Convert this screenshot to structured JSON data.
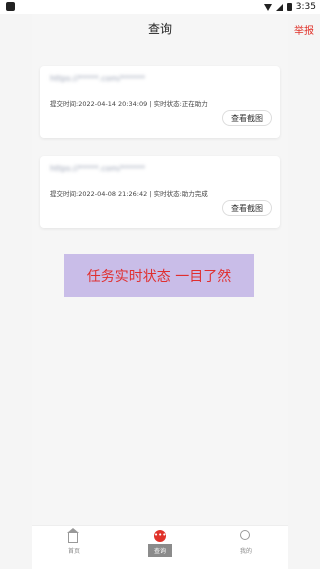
{
  "status_bar": {
    "time": "3:35",
    "icons": [
      "wifi-icon",
      "signal-icon",
      "battery-icon"
    ]
  },
  "header": {
    "title": "查询",
    "report_label": "举报"
  },
  "records": [
    {
      "url_masked": "https://*****.com/******",
      "submit_time_label": "提交时间:",
      "submit_time": "2022-04-14 20:34:09",
      "status_label": "实时状态:",
      "status": "正在助力",
      "view_button": "查看截图"
    },
    {
      "url_masked": "https://*****.com/******",
      "submit_time_label": "提交时间:",
      "submit_time": "2022-04-08 21:26:42",
      "status_label": "实时状态:",
      "status": "助力完成",
      "view_button": "查看截图"
    }
  ],
  "banner": {
    "text": "任务实时状态 一目了然",
    "background_color": "#c9bde8",
    "text_color": "#e02f2f"
  },
  "tabbar": {
    "items": [
      {
        "label": "首页",
        "icon": "home-icon"
      },
      {
        "label": "查询",
        "icon": "query-icon"
      },
      {
        "label": "我的",
        "icon": "user-icon"
      }
    ]
  },
  "colors": {
    "accent": "#e0322a",
    "background": "#f6f6f6"
  }
}
